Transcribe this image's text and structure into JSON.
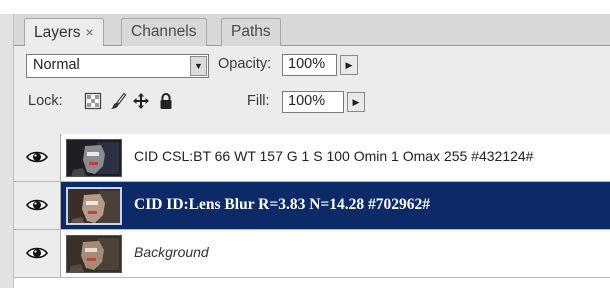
{
  "tabs": [
    {
      "label": "Layers",
      "close": "×",
      "active": true
    },
    {
      "label": "Channels"
    },
    {
      "label": "Paths"
    }
  ],
  "options": {
    "blend_mode": "Normal",
    "opacity_label": "Opacity:",
    "opacity_value": "100%",
    "lock_label": "Lock:",
    "fill_label": "Fill:",
    "fill_value": "100%",
    "lock_icons": [
      "lock-transparent-pixels-icon",
      "lock-image-pixels-brush-icon",
      "lock-position-move-icon",
      "lock-all-padlock-icon"
    ]
  },
  "layers": [
    {
      "name": "CID CSL:BT 66 WT 157 G 1 S 100 Omin 1 Omax 255 #432124#",
      "visible": true,
      "selected": false
    },
    {
      "name": "CID ID:Lens Blur R=3.83 N=14.28 #702962#",
      "visible": true,
      "selected": true
    },
    {
      "name": "Background",
      "visible": true,
      "selected": false
    }
  ],
  "colors": {
    "selection": "#0c2a68",
    "panel_bg": "#ececec",
    "tab_bg": "#d8d8d8"
  }
}
